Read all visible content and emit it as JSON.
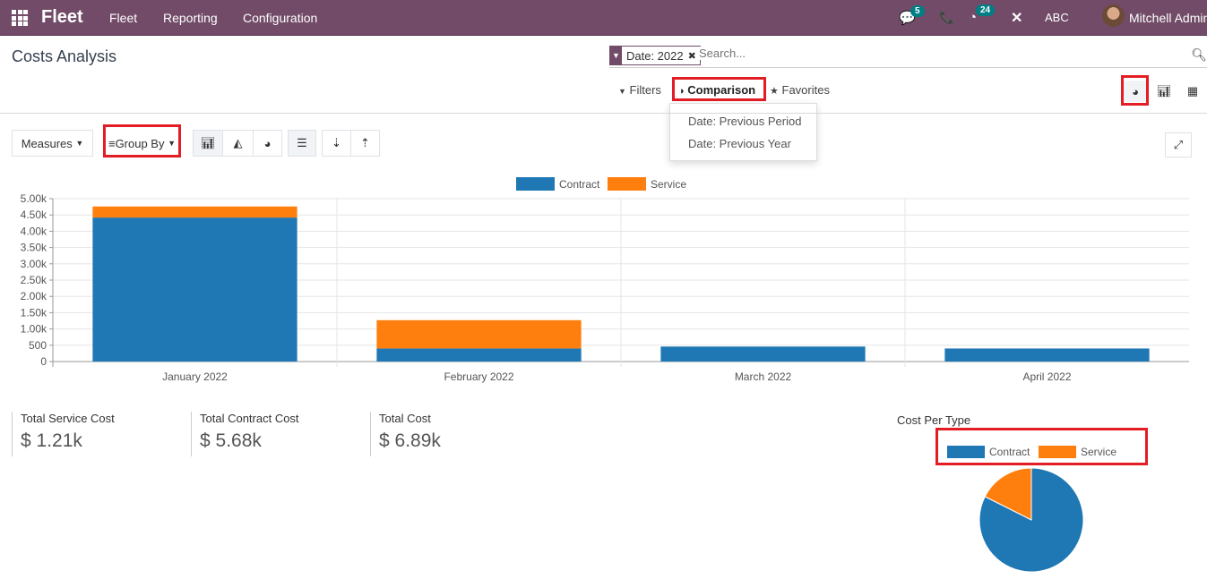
{
  "nav": {
    "brand": "Fleet",
    "menu": [
      "Fleet",
      "Reporting",
      "Configuration"
    ],
    "messages_count": "5",
    "activities_count": "24",
    "company": "ABC",
    "user": "Mitchell Admin"
  },
  "page": {
    "title": "Costs Analysis"
  },
  "search": {
    "facet_label": "Date: 2022",
    "placeholder": "Search..."
  },
  "filters": {
    "filters_label": "Filters",
    "comparison_label": "Comparison",
    "favorites_label": "Favorites",
    "comparison_options": [
      "Date: Previous Period",
      "Date: Previous Year"
    ]
  },
  "toolbar": {
    "measures_label": "Measures",
    "group_by_label": "Group By"
  },
  "kpis": [
    {
      "label": "Total Service Cost",
      "value": "$ 1.21k"
    },
    {
      "label": "Total Contract Cost",
      "value": "$ 5.68k"
    },
    {
      "label": "Total Cost",
      "value": "$ 6.89k"
    }
  ],
  "chart_data": [
    {
      "type": "bar",
      "stacked": true,
      "categories": [
        "January 2022",
        "February 2022",
        "March 2022",
        "April 2022"
      ],
      "series": [
        {
          "name": "Contract",
          "color": "#1f77b4",
          "values": [
            4420,
            400,
            460,
            400
          ]
        },
        {
          "name": "Service",
          "color": "#ff7f0e",
          "values": [
            340,
            870,
            0,
            0
          ]
        }
      ],
      "ylim": [
        0,
        5000
      ],
      "yticks": [
        "0",
        "500",
        "1.00k",
        "1.50k",
        "2.00k",
        "2.50k",
        "3.00k",
        "3.50k",
        "4.00k",
        "4.50k",
        "5.00k"
      ],
      "legend": "top-center",
      "grid": true
    },
    {
      "type": "pie",
      "title": "Cost Per Type",
      "labels": [
        "Contract",
        "Service"
      ],
      "values": [
        5680,
        1210
      ],
      "colors": [
        "#1f77b4",
        "#ff7f0e"
      ],
      "legend": "top"
    }
  ]
}
